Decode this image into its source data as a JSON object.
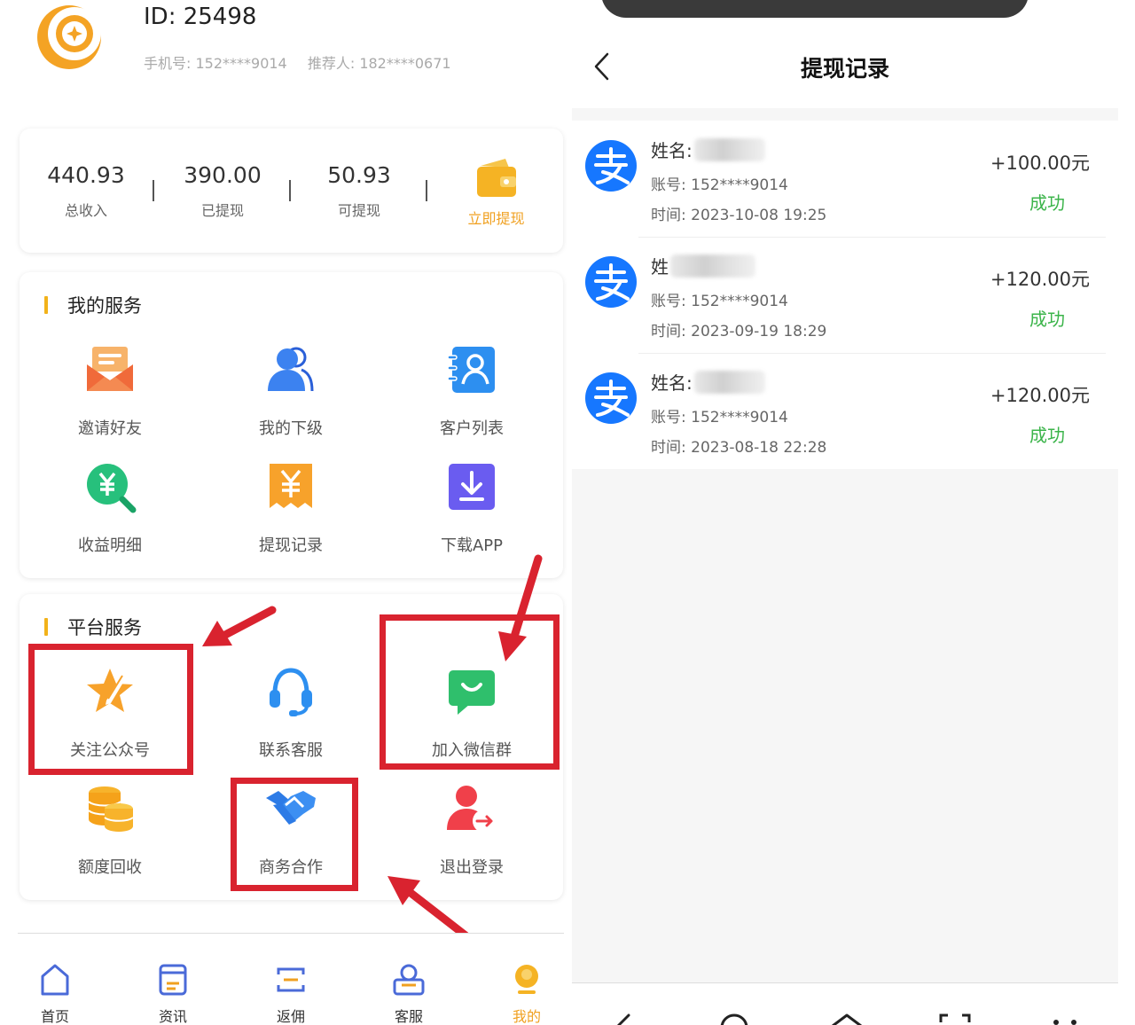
{
  "profile": {
    "id": "ID: 25498",
    "phone": "手机号: 152****9014",
    "referrer": "推荐人: 182****0671"
  },
  "stats": {
    "total_income": {
      "value": "440.93",
      "label": "总收入"
    },
    "withdrawn": {
      "value": "390.00",
      "label": "已提现"
    },
    "available": {
      "value": "50.93",
      "label": "可提现"
    },
    "withdraw_now": "立即提现"
  },
  "my_services": {
    "title": "我的服务",
    "items": [
      {
        "label": "邀请好友",
        "icon": "envelope-icon"
      },
      {
        "label": "我的下级",
        "icon": "users-icon"
      },
      {
        "label": "客户列表",
        "icon": "contacts-icon"
      },
      {
        "label": "收益明细",
        "icon": "yuan-search-icon"
      },
      {
        "label": "提现记录",
        "icon": "yuan-ticket-icon"
      },
      {
        "label": "下载APP",
        "icon": "download-icon"
      }
    ]
  },
  "platform_services": {
    "title": "平台服务",
    "items": [
      {
        "label": "关注公众号",
        "icon": "star-pen-icon"
      },
      {
        "label": "联系客服",
        "icon": "headset-icon"
      },
      {
        "label": "加入微信群",
        "icon": "chat-icon"
      },
      {
        "label": "额度回收",
        "icon": "coins-icon"
      },
      {
        "label": "商务合作",
        "icon": "handshake-icon"
      },
      {
        "label": "退出登录",
        "icon": "logout-user-icon"
      }
    ]
  },
  "bottom_nav": [
    {
      "label": "首页",
      "icon": "home-icon"
    },
    {
      "label": "资讯",
      "icon": "news-icon"
    },
    {
      "label": "返佣",
      "icon": "rebate-icon"
    },
    {
      "label": "客服",
      "icon": "service-icon"
    },
    {
      "label": "我的",
      "icon": "profile-icon",
      "active": true
    }
  ],
  "withdraw_page": {
    "title": "提现记录",
    "records": [
      {
        "name_label": "姓名:",
        "account": "账号: 152****9014",
        "time": "时间: 2023-10-08 19:25",
        "amount": "+100.00元",
        "status": "成功"
      },
      {
        "name_label": "姓",
        "account": "账号: 152****9014",
        "time": "时间: 2023-09-19 18:29",
        "amount": "+120.00元",
        "status": "成功"
      },
      {
        "name_label": "姓名:",
        "account": "账号: 152****9014",
        "time": "时间: 2023-08-18 22:28",
        "amount": "+120.00元",
        "status": "成功"
      }
    ]
  },
  "colors": {
    "accent": "#f0a020",
    "success": "#3bb44a",
    "highlight": "#d9232f",
    "alipay": "#1677ff"
  }
}
